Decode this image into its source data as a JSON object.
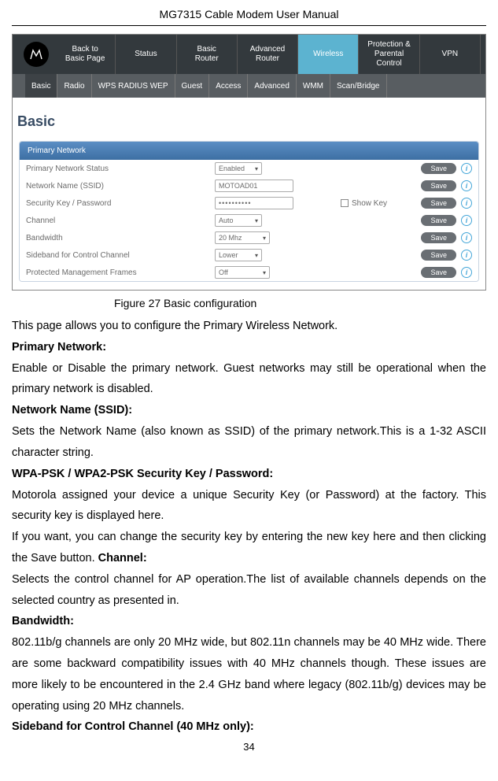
{
  "header": "MG7315 Cable Modem User Manual",
  "screenshot": {
    "top_nav": [
      "Back to\nBasic Page",
      "Status",
      "Basic\nRouter",
      "Advanced\nRouter",
      "Wireless",
      "Protection &\nParental Control",
      "VPN"
    ],
    "top_nav_active_index": 4,
    "sub_nav": [
      "Basic",
      "Radio",
      "WPS RADIUS WEP",
      "Guest",
      "Access",
      "Advanced",
      "WMM",
      "Scan/Bridge"
    ],
    "sub_nav_active_index": 0,
    "section_title": "Basic",
    "panel_title": "Primary Network",
    "rows": [
      {
        "label": "Primary Network Status",
        "control": {
          "type": "select",
          "value": "Enabled"
        }
      },
      {
        "label": "Network Name (SSID)",
        "control": {
          "type": "input",
          "value": "MOTOAD01"
        }
      },
      {
        "label": "Security Key / Password",
        "control": {
          "type": "password",
          "value": "••••••••••"
        },
        "extra": {
          "type": "checkbox",
          "label": "Show Key"
        }
      },
      {
        "label": "Channel",
        "control": {
          "type": "select",
          "value": "Auto"
        }
      },
      {
        "label": "Bandwidth",
        "control": {
          "type": "select",
          "value": "20 Mhz",
          "wide": true
        }
      },
      {
        "label": "Sideband for Control Channel",
        "control": {
          "type": "select",
          "value": "Lower"
        }
      },
      {
        "label": "Protected Management Frames",
        "control": {
          "type": "select",
          "value": "Off",
          "wide": true
        }
      }
    ],
    "save_label": "Save"
  },
  "figure_caption": "Figure 27 Basic configuration",
  "intro": "This page allows you to configure the Primary Wireless Network.",
  "sections": [
    {
      "heading": "Primary Network:",
      "text": "Enable or Disable the primary network. Guest networks may still be operational when the primary network is disabled."
    },
    {
      "heading": "Network Name (SSID):",
      "text": "Sets the Network Name (also known as SSID) of the primary network.This is a 1-32 ASCII character string."
    },
    {
      "heading": "WPA-PSK / WPA2-PSK Security Key / Password:",
      "text": "Motorola assigned your device a unique Security Key (or Password) at the factory. This security key is displayed here."
    }
  ],
  "mixed_paragraph_pre": "If you want, you can change the security key by entering the new key here and then clicking the Save button. ",
  "mixed_paragraph_heading": "Channel:",
  "channel_text": "Selects the control channel for AP operation.The list of available channels depends on the selected country as presented in.",
  "bandwidth_heading": "Bandwidth:",
  "bandwidth_text": "802.11b/g channels are only 20 MHz wide, but 802.11n channels may be 40 MHz wide. There are some backward compatibility issues with 40 MHz channels though. These issues are more likely to be encountered in the 2.4 GHz band where legacy (802.11b/g) devices may be operating using 20 MHz channels.",
  "sideband_heading": "Sideband for Control Channel (40 MHz only):",
  "page_number": "34"
}
